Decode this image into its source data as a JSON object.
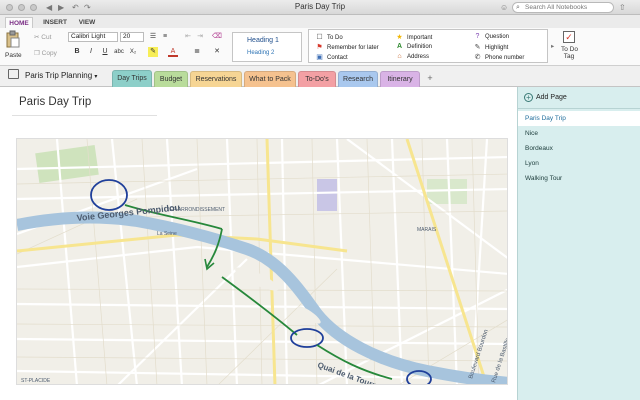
{
  "window": {
    "title": "Paris Day Trip"
  },
  "search": {
    "placeholder": "Search All Notebooks"
  },
  "ribbon_tabs": [
    {
      "label": "HOME",
      "active": true
    },
    {
      "label": "INSERT",
      "active": false
    },
    {
      "label": "VIEW",
      "active": false
    }
  ],
  "clipboard": {
    "paste": "Paste",
    "cut": "Cut",
    "copy": "Copy"
  },
  "font": {
    "family": "Calibri Light",
    "size": "20"
  },
  "styles": {
    "heading1": "Heading 1",
    "heading2": "Heading 2"
  },
  "tags": [
    {
      "icon": "checkbox-icon",
      "glyph": "☐",
      "label": "To Do",
      "color": "#555555"
    },
    {
      "icon": "star-icon",
      "glyph": "★",
      "label": "Important",
      "color": "#f2b705"
    },
    {
      "icon": "question-icon",
      "glyph": "?",
      "label": "Question",
      "color": "#7a3fb0"
    },
    {
      "icon": "flag-icon",
      "glyph": "⚑",
      "label": "Remember for later",
      "color": "#d6372b"
    },
    {
      "icon": "definition-icon",
      "glyph": "A",
      "label": "Definition",
      "color": "#2f8a2f"
    },
    {
      "icon": "highlight-icon",
      "glyph": "✎",
      "label": "Highlight",
      "color": "#444444"
    },
    {
      "icon": "contact-icon",
      "glyph": "▣",
      "label": "Contact",
      "color": "#3f6fb5"
    },
    {
      "icon": "address-icon",
      "glyph": "⌂",
      "label": "Address",
      "color": "#c4662b"
    },
    {
      "icon": "phone-icon",
      "glyph": "✆",
      "label": "Phone number",
      "color": "#444444"
    }
  ],
  "todo_tag": {
    "label1": "To Do",
    "label2": "Tag"
  },
  "notebook": {
    "name": "Paris Trip Planning"
  },
  "sections": [
    {
      "label": "Day Trips",
      "color": "#8dcfc9",
      "active": true
    },
    {
      "label": "Budget",
      "color": "#b9dc9b"
    },
    {
      "label": "Reservations",
      "color": "#f6d594"
    },
    {
      "label": "What to Pack",
      "color": "#f5c28f"
    },
    {
      "label": "To-Do's",
      "color": "#f3a0a4"
    },
    {
      "label": "Research",
      "color": "#a9c8ee"
    },
    {
      "label": "Itinerary",
      "color": "#d9b3e6"
    }
  ],
  "page": {
    "title": "Paris Day Trip"
  },
  "pages_panel": {
    "add_label": "Add Page",
    "items": [
      {
        "label": "Paris Day Trip",
        "active": true
      },
      {
        "label": "Nice"
      },
      {
        "label": "Bordeaux"
      },
      {
        "label": "Lyon"
      },
      {
        "label": "Walking Tour"
      }
    ]
  },
  "map_labels": {
    "voie": "Voie Georges Pompidou",
    "seine": "La Seine",
    "quai": "Quai de la Tournelle",
    "st_placide": "ST-PLACIDE",
    "arrondissement": "1ER ARRONDISSEMENT",
    "marais": "MARAIS",
    "bourdon": "Boulevard Bourdon",
    "bastille": "Rue de la Bastille"
  }
}
